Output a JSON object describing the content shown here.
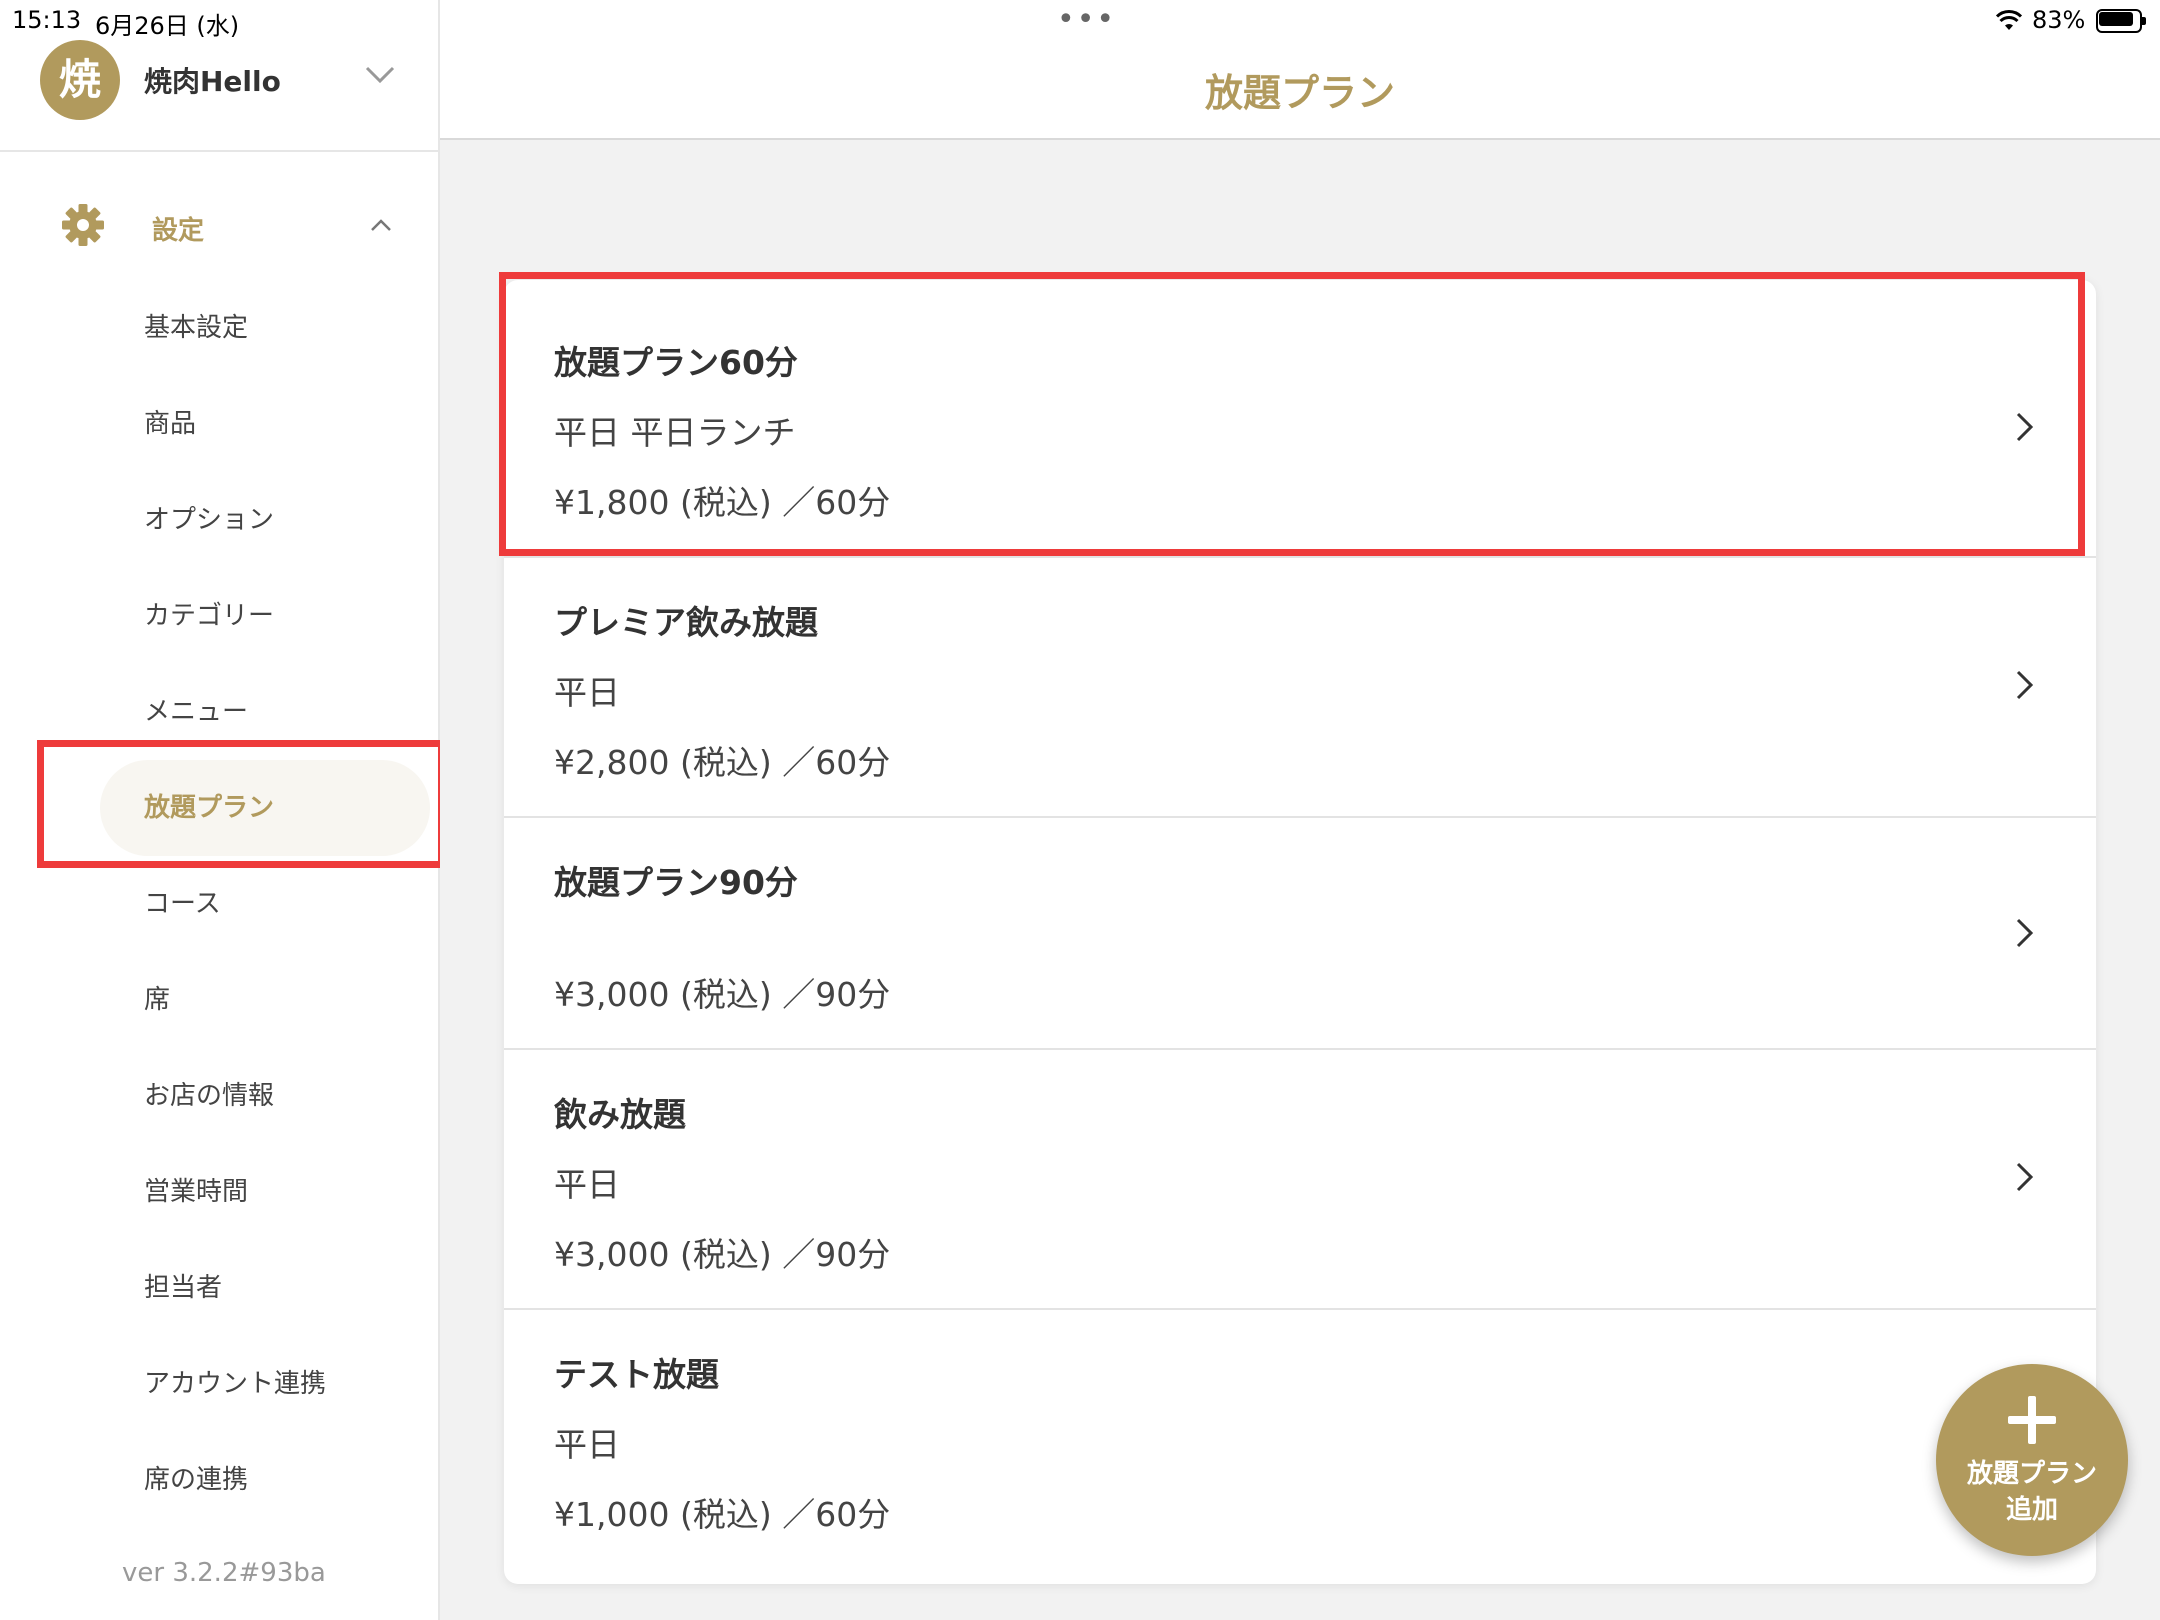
{
  "status_bar": {
    "time": "15:13",
    "date": "6月26日 (水)",
    "multitask_dots": "•••",
    "battery_percent": "83%"
  },
  "sidebar": {
    "shop": {
      "avatar_char": "焼",
      "name": "焼肉Hello"
    },
    "section": {
      "label": "設定",
      "icon": "gear-icon",
      "expanded": true
    },
    "items": [
      {
        "label": "基本設定"
      },
      {
        "label": "商品"
      },
      {
        "label": "オプション"
      },
      {
        "label": "カテゴリー"
      },
      {
        "label": "メニュー"
      },
      {
        "label": "放題プラン",
        "active": true
      },
      {
        "label": "コース"
      },
      {
        "label": "席"
      },
      {
        "label": "お店の情報"
      },
      {
        "label": "営業時間"
      },
      {
        "label": "担当者"
      },
      {
        "label": "アカウント連携"
      },
      {
        "label": "席の連携"
      }
    ],
    "version": "ver 3.2.2#93ba"
  },
  "main": {
    "title": "放題プラン",
    "plans": [
      {
        "name": "放題プラン60分",
        "days": "平日 平日ランチ",
        "price": "¥1,800 (税込) ／60分"
      },
      {
        "name": "プレミア飲み放題",
        "days": "平日",
        "price": "¥2,800 (税込) ／60分"
      },
      {
        "name": "放題プラン90分",
        "days": "",
        "price": "¥3,000 (税込) ／90分"
      },
      {
        "name": "飲み放題",
        "days": "平日",
        "price": "¥3,000 (税込) ／90分"
      },
      {
        "name": "テスト放題",
        "days": "平日",
        "price": "¥1,000 (税込) ／60分"
      }
    ],
    "add_button": {
      "line1": "放題プラン",
      "line2": "追加"
    }
  },
  "colors": {
    "accent": "#b19a5d",
    "highlight": "#ee3b3b",
    "background": "#f2f2f2"
  }
}
